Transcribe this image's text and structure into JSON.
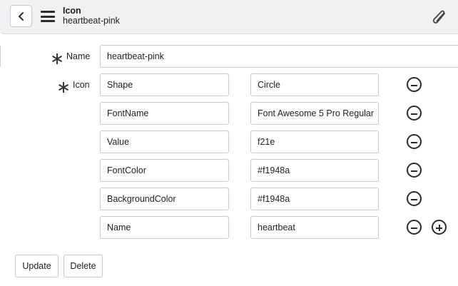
{
  "header": {
    "record_type": "Icon",
    "record_name": "heartbeat-pink",
    "back_icon": "chevron-left-icon",
    "menu_icon": "hamburger-menu-icon",
    "attach_icon": "paperclip-icon"
  },
  "form": {
    "name_field": {
      "label": "Name",
      "required_marker": "∗",
      "value": "heartbeat-pink"
    },
    "icon_field": {
      "label": "Icon",
      "required_marker": "∗",
      "rows": [
        {
          "key": "Shape",
          "value": "Circle"
        },
        {
          "key": "FontName",
          "value": "Font Awesome 5 Pro Regular"
        },
        {
          "key": "Value",
          "value": "f21e"
        },
        {
          "key": "FontColor",
          "value": "#f1948a"
        },
        {
          "key": "BackgroundColor",
          "value": "#f1948a"
        },
        {
          "key": "Name",
          "value": "heartbeat"
        }
      ],
      "remove_icon": "minus-circle-icon",
      "add_icon": "plus-circle-icon"
    }
  },
  "actions": {
    "update_label": "Update",
    "delete_label": "Delete"
  }
}
